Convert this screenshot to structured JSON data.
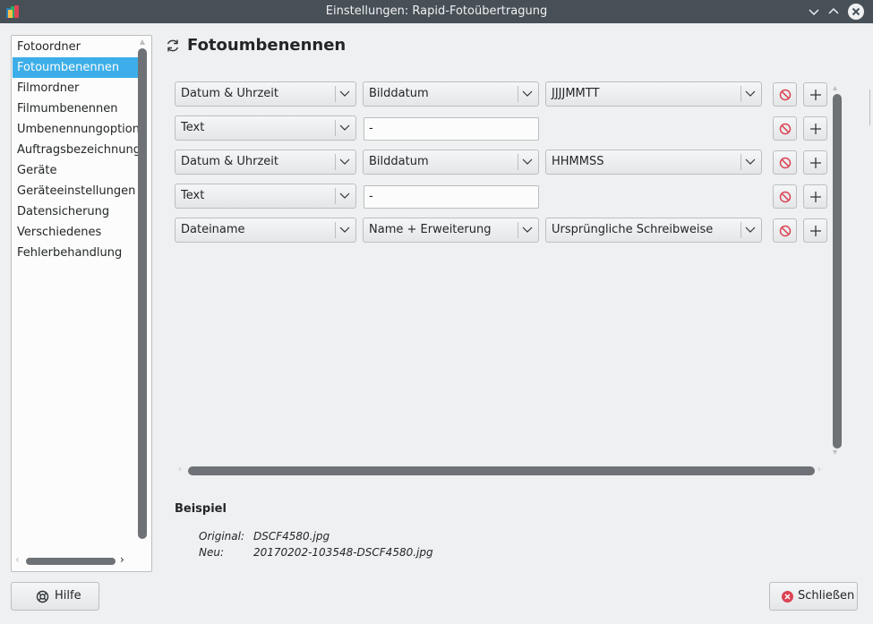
{
  "window": {
    "title": "Einstellungen: Rapid-Fotoübertragung"
  },
  "sidebar": {
    "items": [
      {
        "label": "Fotoordner",
        "active": false
      },
      {
        "label": "Fotoumbenennen",
        "active": true
      },
      {
        "label": "Filmordner",
        "active": false
      },
      {
        "label": "Filmumbenennen",
        "active": false
      },
      {
        "label": "Umbenennungoptionen",
        "active": false
      },
      {
        "label": "Auftragsbezeichnungen",
        "active": false
      },
      {
        "label": "Geräte",
        "active": false
      },
      {
        "label": "Geräteeinstellungen",
        "active": false
      },
      {
        "label": "Datensicherung",
        "active": false
      },
      {
        "label": "Verschiedenes",
        "active": false
      },
      {
        "label": "Fehlerbehandlung",
        "active": false
      }
    ]
  },
  "page": {
    "title": "Fotoumbenennen",
    "icon": "refresh-icon"
  },
  "rows": [
    {
      "type": "Datum & Uhrzeit",
      "element": "Bilddatum",
      "format": "JJJJMMTT"
    },
    {
      "type": "Text",
      "text": "-"
    },
    {
      "type": "Datum & Uhrzeit",
      "element": "Bilddatum",
      "format": "HHMMSS"
    },
    {
      "type": "Text",
      "text": "-"
    },
    {
      "type": "Dateiname",
      "element": "Name + Erweiterung",
      "format": "Ursprüngliche Schreibweise"
    }
  ],
  "example": {
    "heading": "Beispiel",
    "original_label": "Original:",
    "original_value": "DSCF4580.jpg",
    "new_label": "Neu:",
    "new_value": "20170202-103548-DSCF4580.jpg"
  },
  "buttons": {
    "help": "Hilfe",
    "close": "Schließen"
  },
  "colors": {
    "accent": "#3daee9",
    "titlebar": "#475057",
    "remove_icon": "#da4453"
  }
}
